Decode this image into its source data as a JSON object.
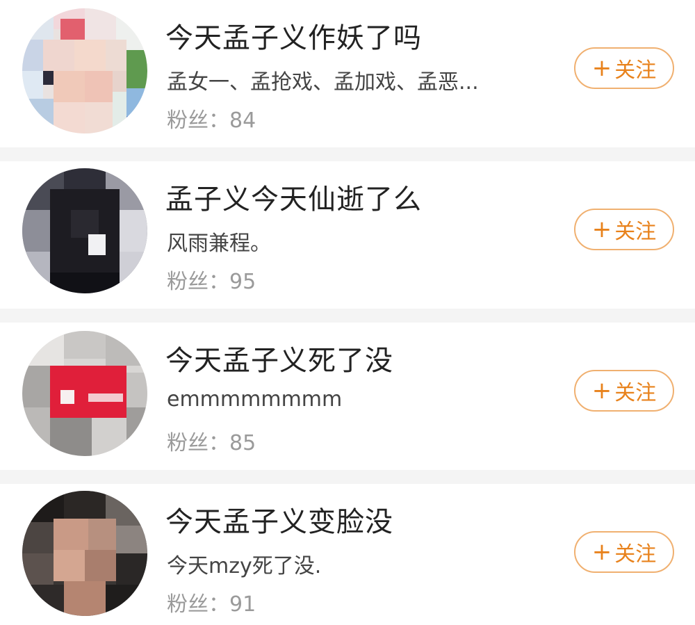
{
  "colors": {
    "accent": "#e8821c",
    "button_border": "#f0b070",
    "divider": "#f4f4f4",
    "name_text": "#222222",
    "muted_text": "#9a9a9a"
  },
  "users": [
    {
      "name": "今天孟子义作妖了吗",
      "bio": "孟女一、孟抢戏、孟加戏、孟恶...",
      "fans_label": "粉丝：",
      "fans_count": "84",
      "follow_icon": "plus-icon",
      "follow_plus": "+",
      "follow_label": "关注"
    },
    {
      "name": "孟子义今天仙逝了么",
      "bio": "风雨兼程。",
      "fans_label": "粉丝：",
      "fans_count": "95",
      "follow_icon": "plus-icon",
      "follow_plus": "+",
      "follow_label": "关注"
    },
    {
      "name": "今天孟子义死了没",
      "bio": "emmmmmmmm",
      "fans_label": "粉丝：",
      "fans_count": "85",
      "follow_icon": "plus-icon",
      "follow_plus": "+",
      "follow_label": "关注"
    },
    {
      "name": "今天孟子义变脸没",
      "bio": "今天mzy死了没.",
      "fans_label": "粉丝：",
      "fans_count": "91",
      "follow_icon": "plus-icon",
      "follow_plus": "+",
      "follow_label": "关注"
    }
  ]
}
